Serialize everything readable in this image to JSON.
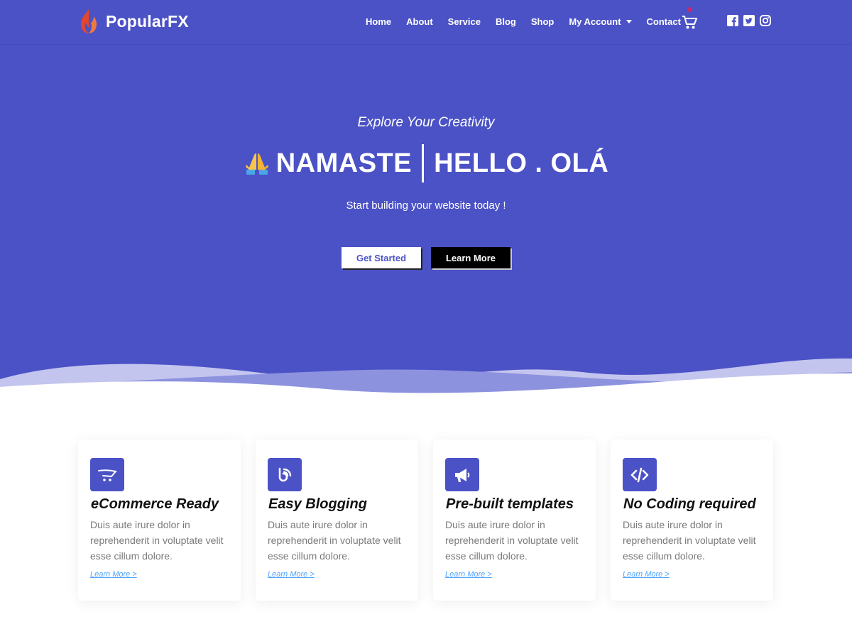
{
  "header": {
    "logo_text": "PopularFX",
    "nav": [
      {
        "label": "Home"
      },
      {
        "label": "About"
      },
      {
        "label": "Service"
      },
      {
        "label": "Blog"
      },
      {
        "label": "Shop"
      },
      {
        "label": "My Account",
        "has_dropdown": true
      },
      {
        "label": "Contact"
      }
    ],
    "cart_count": "0",
    "social": [
      "facebook-icon",
      "twitter-icon",
      "instagram-icon"
    ]
  },
  "hero": {
    "tagline": "Explore Your Creativity",
    "headline_left": "NAMASTE",
    "headline_right": "HELLO . OLÁ",
    "subtitle": "Start building your website today !",
    "btn_primary": "Get Started",
    "btn_secondary": "Learn More"
  },
  "features": [
    {
      "icon": "shopping-cart-icon",
      "title": "eCommerce Ready",
      "desc": "Duis aute irure dolor in reprehenderit in voluptate velit esse cillum dolore.",
      "link": "Learn More >"
    },
    {
      "icon": "blog-feed-icon",
      "title": "Easy Blogging",
      "desc": "Duis aute irure dolor in reprehenderit in voluptate velit esse cillum dolore.",
      "link": "Learn More >"
    },
    {
      "icon": "megaphone-icon",
      "title": "Pre-built templates",
      "desc": "Duis aute irure dolor in reprehenderit in voluptate velit esse cillum dolore.",
      "link": "Learn More >"
    },
    {
      "icon": "code-icon",
      "title": "No Coding required",
      "desc": "Duis aute irure dolor in reprehenderit in voluptate velit esse cillum dolore.",
      "link": "Learn More >"
    }
  ],
  "colors": {
    "primary": "#4b52c6",
    "wave_light": "#c3c5ee",
    "wave_mid": "#8d92df",
    "cart_badge": "#e0245e",
    "link": "#4da3ff"
  }
}
